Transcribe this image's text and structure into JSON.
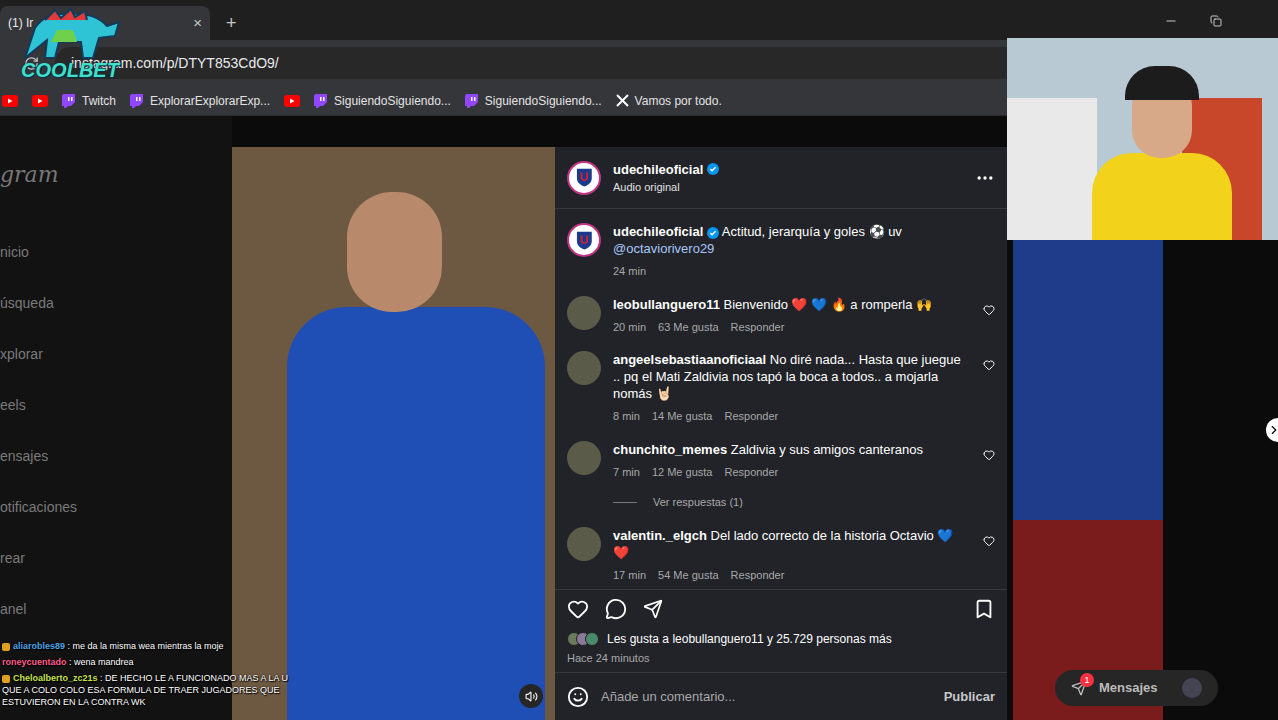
{
  "browser": {
    "tabs": [
      {
        "label": "(1) Ir",
        "close": "×",
        "selected": true
      }
    ],
    "new_tab": "+",
    "address": "instagram.com/p/DTYT853CdO9/",
    "bookmarks": [
      {
        "kind": "youtube",
        "label": ""
      },
      {
        "kind": "youtube",
        "label": ""
      },
      {
        "kind": "twitch",
        "label": "Twitch"
      },
      {
        "kind": "twitch",
        "label": "ExplorarExplorarExp..."
      },
      {
        "kind": "youtube",
        "label": ""
      },
      {
        "kind": "twitch",
        "label": "SiguiendoSiguiendo..."
      },
      {
        "kind": "twitch",
        "label": "SiguiendoSiguiendo..."
      },
      {
        "kind": "x",
        "label": "Vamos por todo."
      }
    ]
  },
  "stream_logo": {
    "text": "COOLBET"
  },
  "sidebar": {
    "logo": "gram",
    "items": [
      "nicio",
      "úsqueda",
      "xplorar",
      "eels",
      "ensajes",
      "otificaciones",
      "rear",
      "anel"
    ]
  },
  "post": {
    "author": "udechileoficial",
    "verified": true,
    "audio": "Audio original",
    "caption": {
      "text": "Actitud, jerarquía y goles ⚽ uv",
      "mention": "@octaviorivero29",
      "time": "24 min"
    },
    "comments": [
      {
        "user": "leobullanguero11",
        "text": "Bienvenido ❤️ 💙 🔥 a romperla 🙌",
        "time": "20 min",
        "likes": "63 Me gusta",
        "reply": "Responder",
        "replies": "",
        "liked": false
      },
      {
        "user": "angeelsebastiaanoficiaal",
        "text": "No diré nada... Hasta que juegue .. pq el Mati Zaldivia nos tapó la boca a todos.. a mojarla nomás 🤘🏻",
        "time": "8 min",
        "likes": "14 Me gusta",
        "reply": "Responder",
        "replies": "",
        "liked": false
      },
      {
        "user": "chunchito_memes",
        "text": "Zaldivia y sus amigos canteranos",
        "time": "7 min",
        "likes": "12 Me gusta",
        "reply": "Responder",
        "replies": "Ver respuestas (1)",
        "liked": false
      },
      {
        "user": "valentin._elgch",
        "text": "Del lado correcto de la historia Octavio 💙❤️",
        "time": "17 min",
        "likes": "54 Me gusta",
        "reply": "Responder",
        "replies": "",
        "liked": false
      }
    ],
    "liked": false,
    "saved": false,
    "likes_text": "Les gusta a leobullanguero11 y 25.729 personas más",
    "posted": "Hace 24 minutos",
    "input_placeholder": "Añade un comentario...",
    "publish": "Publicar"
  },
  "messages_button": {
    "label": "Mensajes",
    "badge": "1"
  },
  "chat": [
    {
      "user": "aliarobles89",
      "text": "me da la misma wea mientras la moje",
      "color": "#4ea3e8",
      "badge": true
    },
    {
      "user": "roneycuentado",
      "text": "wena mandrea",
      "color": "#ff5c8a",
      "badge": false
    },
    {
      "user": "Cheloalberto_zc21s",
      "text": "DE HECHO LE A FUNCIONADO MAS A LA U QUE A COLO COLO ESA FORMULA DE TRAER JUGADORES QUE ESTUVIERON EN LA CONTRA WK",
      "color": "#c6e24a",
      "badge": true
    }
  ]
}
